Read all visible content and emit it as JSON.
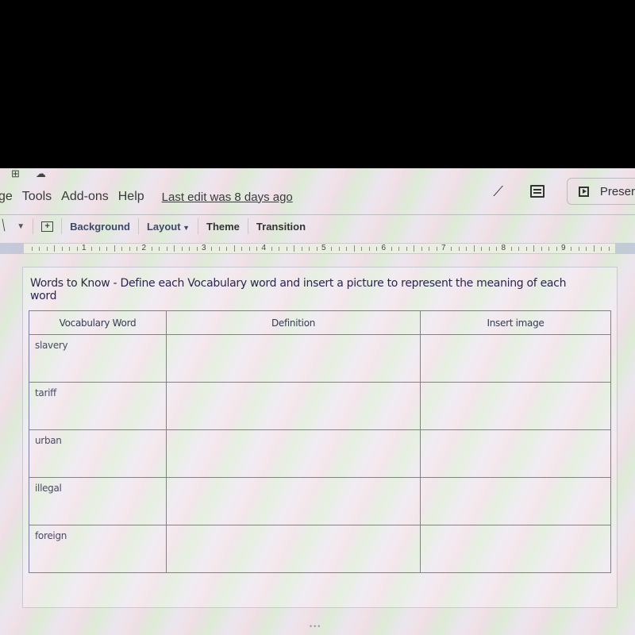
{
  "top_icons": [
    "new-slide-icon",
    "cloud-saved-icon"
  ],
  "menu": {
    "items": [
      "ge",
      "Tools",
      "Add-ons",
      "Help"
    ],
    "last_edit": "Last edit was 8 days ago"
  },
  "header_right": {
    "present_label": "Preser"
  },
  "toolbar": {
    "background": "Background",
    "layout": "Layout",
    "theme": "Theme",
    "transition": "Transition"
  },
  "ruler": {
    "numbers": [
      "1",
      "2",
      "3",
      "4",
      "5",
      "6",
      "7",
      "8",
      "9"
    ]
  },
  "slide": {
    "title_part1": "Words to Know - ",
    "title_part2": "Define each Vocabulary word and insert a picture to represent the meaning of each word",
    "table": {
      "headers": [
        "Vocabulary Word",
        "Definition",
        "Insert image"
      ],
      "rows": [
        {
          "word": "slavery",
          "definition": "",
          "image": ""
        },
        {
          "word": "tariff",
          "definition": "",
          "image": ""
        },
        {
          "word": "urban",
          "definition": "",
          "image": ""
        },
        {
          "word": "illegal",
          "definition": "",
          "image": ""
        },
        {
          "word": "foreign",
          "definition": "",
          "image": ""
        }
      ]
    }
  },
  "colors": {
    "table_border": "#7b7fa6",
    "title_text": "#2d2a44",
    "toolbar_text": "#3b4a6b"
  }
}
